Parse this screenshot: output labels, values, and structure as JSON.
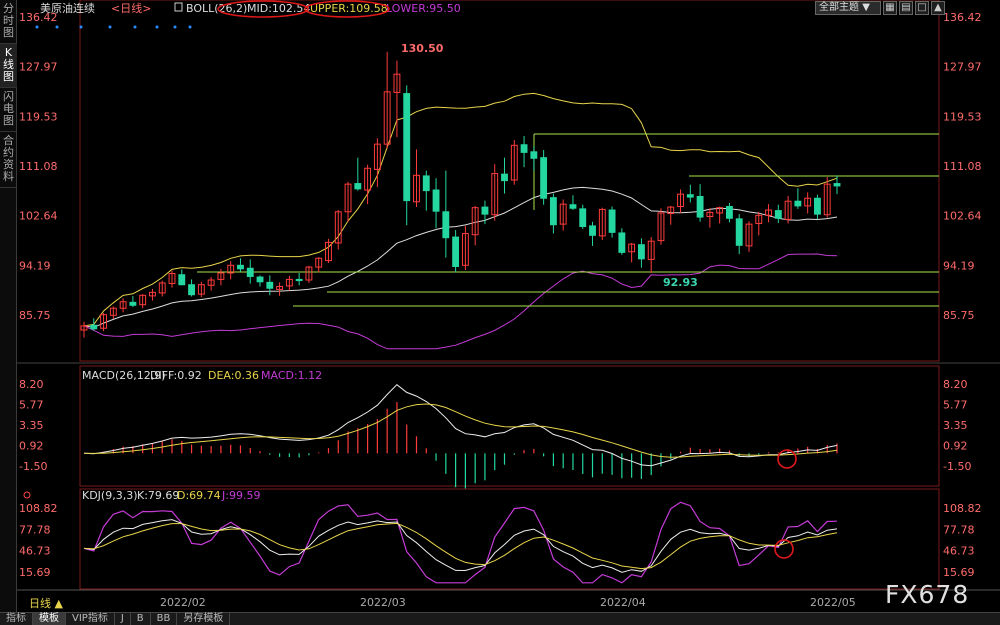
{
  "left_tabs": [
    "分时图",
    "K线图",
    "闪电图",
    "合约资料"
  ],
  "main_legend": {
    "title": "美原油连续",
    "period": "<日线>",
    "boll": "BOLL(26,2)",
    "mid": "MID:102.54",
    "upper": "UPPER:109.58",
    "lower": "LOWER:95.50"
  },
  "theme_button": "全部主题",
  "theme_arrow": "▼",
  "price_ticks": [
    "136.42",
    "127.97",
    "119.53",
    "111.08",
    "102.64",
    "94.19",
    "85.75"
  ],
  "annotations": {
    "high": "130.50",
    "low": "92.93"
  },
  "macd_legend": {
    "name": "MACD(26,12,9)",
    "diff": "DIFF:0.92",
    "dea": "DEA:0.36",
    "macd": "MACD:1.12"
  },
  "macd_ticks": [
    "8.20",
    "5.77",
    "3.35",
    "0.92",
    "-1.50"
  ],
  "kdj_legend": {
    "name": "KDJ(9,3,3)",
    "k": "K:79.69",
    "d": "D:69.74",
    "j": "J:99.59"
  },
  "kdj_ticks": [
    "108.82",
    "77.78",
    "46.73",
    "15.69"
  ],
  "date_labels": [
    "2022/02",
    "2022/03",
    "2022/04",
    "2022/05"
  ],
  "period_label": "日线 ▲",
  "watermark": "FX678",
  "bottom_tabs": [
    "指标",
    "模板",
    "VIP指标",
    "J",
    "B",
    "BB",
    "另存模板"
  ],
  "colors": {
    "up": "#ff3b3b",
    "down": "#24d6a0",
    "mid": "#dddddd",
    "upper": "#e8d44a",
    "lower": "#c43bd6",
    "line": "#a6e34a"
  },
  "candles": [
    [
      83.2,
      84.6,
      81.9,
      83.9
    ],
    [
      84.0,
      85.2,
      83.1,
      83.4
    ],
    [
      83.5,
      86.1,
      83.0,
      85.8
    ],
    [
      85.7,
      87.2,
      85.1,
      86.9
    ],
    [
      86.9,
      88.6,
      86.2,
      88.0
    ],
    [
      87.9,
      89.0,
      87.1,
      87.4
    ],
    [
      87.5,
      89.3,
      86.9,
      89.1
    ],
    [
      89.0,
      90.2,
      88.2,
      89.6
    ],
    [
      89.5,
      91.6,
      88.9,
      91.2
    ],
    [
      91.1,
      93.3,
      90.4,
      92.8
    ],
    [
      92.6,
      93.5,
      90.8,
      90.9
    ],
    [
      90.9,
      91.8,
      88.9,
      89.2
    ],
    [
      89.3,
      91.4,
      88.8,
      90.9
    ],
    [
      90.8,
      92.2,
      89.9,
      91.7
    ],
    [
      91.8,
      93.6,
      90.8,
      92.9
    ],
    [
      92.9,
      94.9,
      91.8,
      94.2
    ],
    [
      94.2,
      95.4,
      93.1,
      93.6
    ],
    [
      93.7,
      95.2,
      91.1,
      92.3
    ],
    [
      92.2,
      92.5,
      90.6,
      91.4
    ],
    [
      91.3,
      92.5,
      89.1,
      90.3
    ],
    [
      90.1,
      91.3,
      89.0,
      90.6
    ],
    [
      90.7,
      92.4,
      89.9,
      91.8
    ],
    [
      91.8,
      92.9,
      90.8,
      91.6
    ],
    [
      91.7,
      94.1,
      91.2,
      93.9
    ],
    [
      93.9,
      95.6,
      93.0,
      95.4
    ],
    [
      95.0,
      98.7,
      94.6,
      98.1
    ],
    [
      98.0,
      103.6,
      96.9,
      103.3
    ],
    [
      103.3,
      108.4,
      101.6,
      108.0
    ],
    [
      108.1,
      112.5,
      106.9,
      107.2
    ],
    [
      107.0,
      111.3,
      104.6,
      110.7
    ],
    [
      110.5,
      115.8,
      107.5,
      114.8
    ],
    [
      114.8,
      130.5,
      114.0,
      123.7
    ],
    [
      123.6,
      129.0,
      116.0,
      126.7
    ],
    [
      123.4,
      124.8,
      101.0,
      105.2
    ],
    [
      105.0,
      113.9,
      104.1,
      109.5
    ],
    [
      109.4,
      110.3,
      103.5,
      106.9
    ],
    [
      107.0,
      109.0,
      100.5,
      103.4
    ],
    [
      103.3,
      110.3,
      95.5,
      98.9
    ],
    [
      99.0,
      100.2,
      93.0,
      94.0
    ],
    [
      94.2,
      100.9,
      93.4,
      99.6
    ],
    [
      99.4,
      104.3,
      97.6,
      104.0
    ],
    [
      104.1,
      105.2,
      101.2,
      102.9
    ],
    [
      102.8,
      111.4,
      101.8,
      109.8
    ],
    [
      109.7,
      112.5,
      106.4,
      108.6
    ],
    [
      108.7,
      115.5,
      107.9,
      114.6
    ],
    [
      114.7,
      116.2,
      110.9,
      113.4
    ],
    [
      113.5,
      114.4,
      110.3,
      112.4
    ],
    [
      112.5,
      113.8,
      104.5,
      105.6
    ],
    [
      105.7,
      106.4,
      99.6,
      101.1
    ],
    [
      101.2,
      105.4,
      100.1,
      104.6
    ],
    [
      104.5,
      106.1,
      103.6,
      103.9
    ],
    [
      103.8,
      104.5,
      100.4,
      100.8
    ],
    [
      100.9,
      101.6,
      97.5,
      99.3
    ],
    [
      99.2,
      104.0,
      98.5,
      103.7
    ],
    [
      103.6,
      104.2,
      98.9,
      99.8
    ],
    [
      99.7,
      100.5,
      96.0,
      96.4
    ],
    [
      96.5,
      98.0,
      94.7,
      97.8
    ],
    [
      97.7,
      98.8,
      93.8,
      95.3
    ],
    [
      95.2,
      99.0,
      92.9,
      98.3
    ],
    [
      98.4,
      103.9,
      97.7,
      103.1
    ],
    [
      103.0,
      104.3,
      101.1,
      104.1
    ],
    [
      104.2,
      107.1,
      103.1,
      106.3
    ],
    [
      106.2,
      107.9,
      104.9,
      105.8
    ],
    [
      105.9,
      108.0,
      101.6,
      102.4
    ],
    [
      102.5,
      103.9,
      100.6,
      103.2
    ],
    [
      103.1,
      104.2,
      101.3,
      104.0
    ],
    [
      104.2,
      104.8,
      101.5,
      102.2
    ],
    [
      102.1,
      102.9,
      96.1,
      97.6
    ],
    [
      97.5,
      101.7,
      96.5,
      101.2
    ],
    [
      101.3,
      103.3,
      99.3,
      102.7
    ],
    [
      102.7,
      104.6,
      101.5,
      103.6
    ],
    [
      103.5,
      104.5,
      101.4,
      102.2
    ],
    [
      102.0,
      106.0,
      101.3,
      105.1
    ],
    [
      105.1,
      107.3,
      103.8,
      104.3
    ],
    [
      104.3,
      106.6,
      103.0,
      105.6
    ],
    [
      105.6,
      106.2,
      102.0,
      102.9
    ],
    [
      102.8,
      109.2,
      102.3,
      108.0
    ],
    [
      108.1,
      109.5,
      106.3,
      107.7
    ]
  ]
}
